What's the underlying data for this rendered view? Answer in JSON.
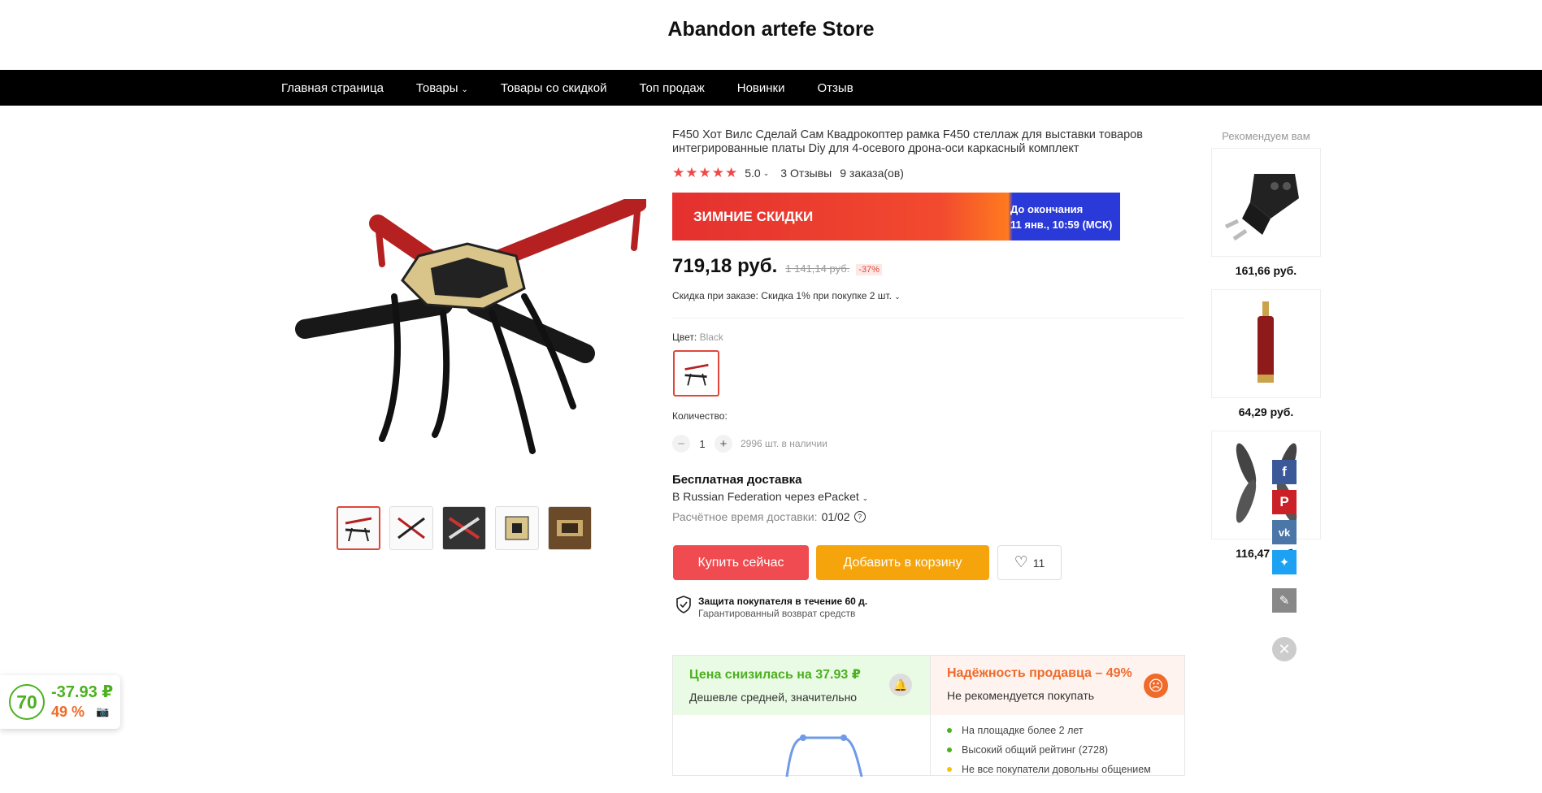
{
  "store": {
    "title": "Abandon artefe Store"
  },
  "nav": {
    "home": "Главная страница",
    "products": "Товары",
    "sale": "Товары со скидкой",
    "top": "Топ продаж",
    "new": "Новинки",
    "review": "Отзыв"
  },
  "product": {
    "title": "F450 Хот Вилс Сделай Сам Квадрокоптер рамка F450 стеллаж для выставки товаров интегрированные платы Diy для 4-осевого дрона-оси каркасный комплект",
    "rating": "5.0",
    "reviews": "3 Отзывы",
    "orders": "9 заказа(ов)",
    "stars": 5
  },
  "promo": {
    "label": "ЗИМНИЕ СКИДКИ",
    "until_line1": "До окончания",
    "until_line2": "11 янв., 10:59 (МСК)"
  },
  "price": {
    "current": "719,18 руб.",
    "old": "1 141,14 руб.",
    "off": "-37%",
    "discount_note": "Скидка при заказе: Скидка 1% при покупке 2 шт."
  },
  "color": {
    "label": "Цвет:",
    "value": "Black"
  },
  "quantity": {
    "label": "Количество:",
    "value": "1",
    "stock": "2996 шт. в наличии"
  },
  "shipping": {
    "title": "Бесплатная доставка",
    "route": "В Russian Federation через ePacket",
    "time_label": "Расчётное время доставки:",
    "time_value": "01/02"
  },
  "actions": {
    "buy": "Купить сейчас",
    "cart": "Добавить в корзину",
    "wish_count": "11"
  },
  "protection": {
    "title": "Защита покупателя в течение 60 д.",
    "subtitle": "Гарантированный возврат средств"
  },
  "analysis": {
    "price_title": "Цена снизилась на 37.93 ₽",
    "price_sub": "Дешевле средней, значительно",
    "seller_title": "Надёжность продавца – 49%",
    "seller_sub": "Не рекомендуется покупать",
    "reasons": [
      "На площадке более 2 лет",
      "Высокий общий рейтинг (2728)",
      "Не все покупатели довольны общением"
    ]
  },
  "recommend": {
    "title": "Рекомендуем вам",
    "items": [
      {
        "price": "161,66 руб."
      },
      {
        "price": "64,29 руб."
      },
      {
        "price": "116,47 руб."
      }
    ]
  },
  "widget": {
    "score": "70",
    "change": "-37.93 ₽",
    "percent": "49 %"
  },
  "colors": {
    "accent": "#f04b50",
    "cart": "#f5a40c",
    "green": "#4cb020",
    "orange": "#f06a2a"
  }
}
